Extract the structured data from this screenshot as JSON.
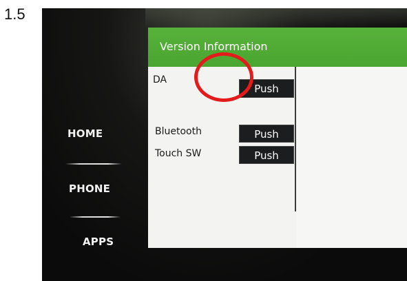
{
  "step_number": "1.5",
  "nav": {
    "home_label": "HOME",
    "phone_label": "PHONE",
    "apps_label": "APPS"
  },
  "screen": {
    "title": "Version Information",
    "title_bar_color": "#4fae36",
    "rows": [
      {
        "label": "DA",
        "button_label": "Push"
      },
      {
        "label": "Bluetooth",
        "button_label": "Push"
      },
      {
        "label": "Touch SW",
        "button_label": "Push"
      }
    ]
  },
  "annotation": {
    "highlight_color": "#e41b1b",
    "highlight_target": "DA push button"
  }
}
